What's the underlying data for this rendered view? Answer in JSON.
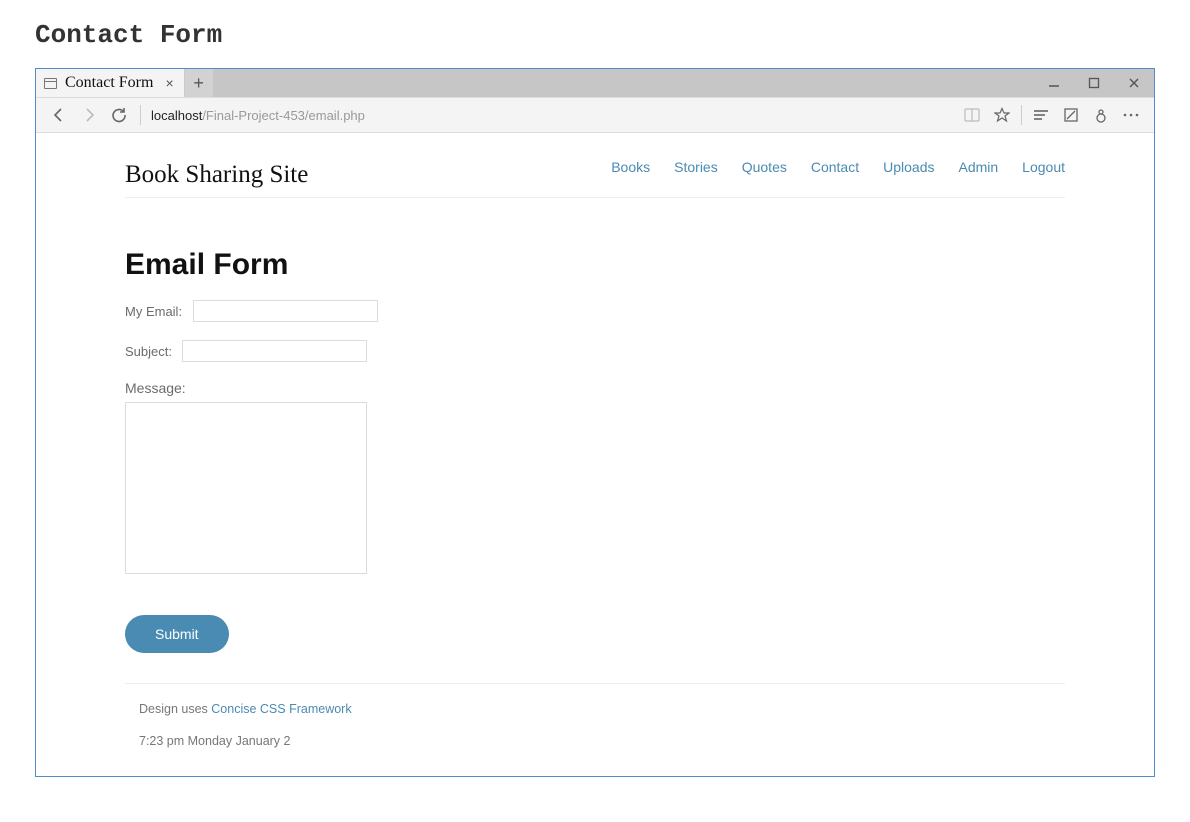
{
  "outer_title": "Contact Form",
  "browser": {
    "tab_title": "Contact Form",
    "url_host": "localhost",
    "url_path": "/Final-Project-453/email.php"
  },
  "site": {
    "title": "Book Sharing Site",
    "nav": {
      "books": "Books",
      "stories": "Stories",
      "quotes": "Quotes",
      "contact": "Contact",
      "uploads": "Uploads",
      "admin": "Admin",
      "logout": "Logout"
    }
  },
  "form": {
    "heading": "Email Form",
    "email_label": "My Email:",
    "subject_label": "Subject:",
    "message_label": "Message:",
    "submit_label": "Submit",
    "email_value": "",
    "subject_value": "",
    "message_value": ""
  },
  "footer": {
    "prefix": "Design uses ",
    "link_text": "Concise CSS Framework",
    "timestamp": "7:23 pm Monday January 2"
  }
}
